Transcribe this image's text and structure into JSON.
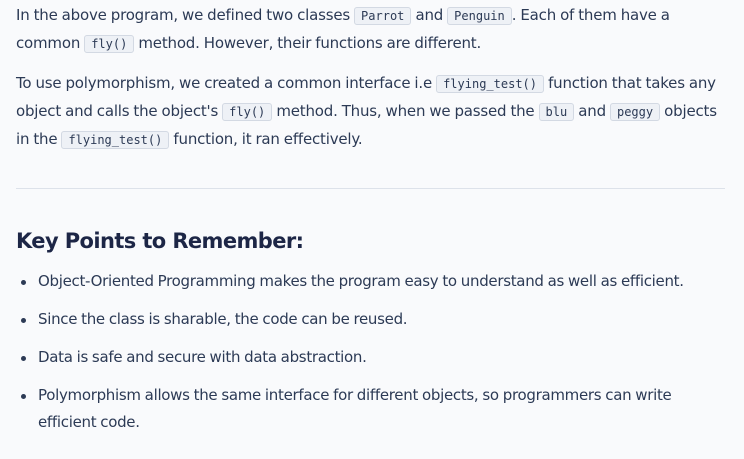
{
  "paragraph1": {
    "t1": "In the above program, we defined two classes ",
    "c1": "Parrot",
    "t2": " and ",
    "c2": "Penguin",
    "t3": ". Each of them have a common ",
    "c3": "fly()",
    "t4": " method. However, their functions are different."
  },
  "paragraph2": {
    "t1": "To use polymorphism, we created a common interface i.e ",
    "c1": "flying_test()",
    "t2": " function that takes any object and calls the object's ",
    "c2": "fly()",
    "t3": " method. Thus, when we passed the ",
    "c3": "blu",
    "t4": " and ",
    "c4": "peggy",
    "t5": " objects in the ",
    "c5": "flying_test()",
    "t6": " function, it ran effectively."
  },
  "key_points": {
    "heading": "Key Points to Remember:",
    "items": [
      "Object-Oriented Programming makes the program easy to understand as well as efficient.",
      "Since the class is sharable, the code can be reused.",
      "Data is safe and secure with data abstraction.",
      "Polymorphism allows the same interface for different objects, so programmers can write efficient code."
    ]
  }
}
